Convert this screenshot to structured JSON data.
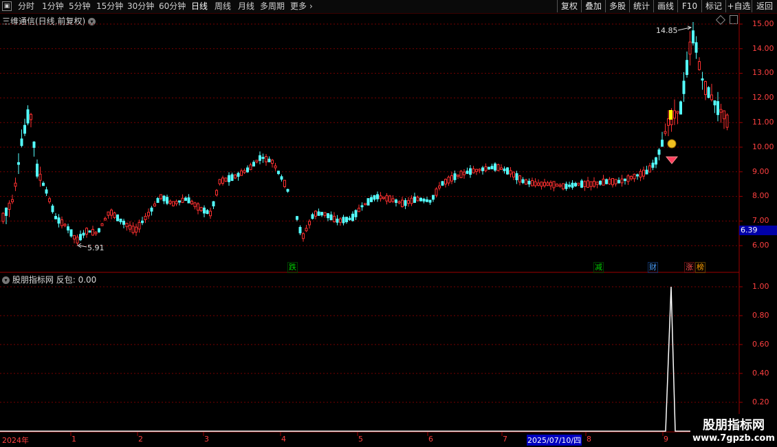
{
  "toolbar": {
    "period_tabs": [
      {
        "label": "分时",
        "active": false
      },
      {
        "label": "1分钟",
        "active": false
      },
      {
        "label": "5分钟",
        "active": false
      },
      {
        "label": "15分钟",
        "active": false
      },
      {
        "label": "30分钟",
        "active": false
      },
      {
        "label": "60分钟",
        "active": false
      },
      {
        "label": "日线",
        "active": true
      },
      {
        "label": "周线",
        "active": false
      },
      {
        "label": "月线",
        "active": false
      },
      {
        "label": "多周期",
        "active": false
      },
      {
        "label": "更多",
        "active": false
      }
    ],
    "right_buttons": [
      "复权",
      "叠加",
      "多股",
      "统计",
      "画线",
      "F10",
      "标记",
      "+自选",
      "返回"
    ]
  },
  "main_chart": {
    "title": "三维通信(日线,前复权)",
    "y_ticks": [
      "15.00",
      "14.00",
      "13.00",
      "12.00",
      "11.00",
      "10.00",
      "9.00",
      "8.00",
      "7.00",
      "6.00"
    ],
    "current_price": "6.39",
    "high_label": "14.85",
    "low_label": "5.91",
    "signals": [
      {
        "label": "跌",
        "color": "#00c000"
      },
      {
        "label": "减",
        "color": "#00c000"
      },
      {
        "label": "财",
        "color": "#4aa0ff"
      },
      {
        "label": "涨",
        "color": "#ff5050"
      },
      {
        "label": "榜",
        "color": "#ffa000"
      }
    ]
  },
  "indicator": {
    "name": "股朋指标网",
    "series_name": "反包",
    "value": "0.00",
    "y_ticks": [
      "1.00",
      "0.80",
      "0.60",
      "0.40",
      "0.20"
    ]
  },
  "x_axis": {
    "labels": [
      "2024年",
      "1",
      "2",
      "3",
      "4",
      "5",
      "6",
      "7",
      "2025/07/10/四",
      "8",
      "9"
    ]
  },
  "watermark": {
    "line1": "股朋指标网",
    "line2": "www.7gpzb.com"
  },
  "colors": {
    "up": "#ff3030",
    "down": "#54ffff",
    "grid": "#800000",
    "axis_text": "#ff4040",
    "background": "#000000"
  }
}
